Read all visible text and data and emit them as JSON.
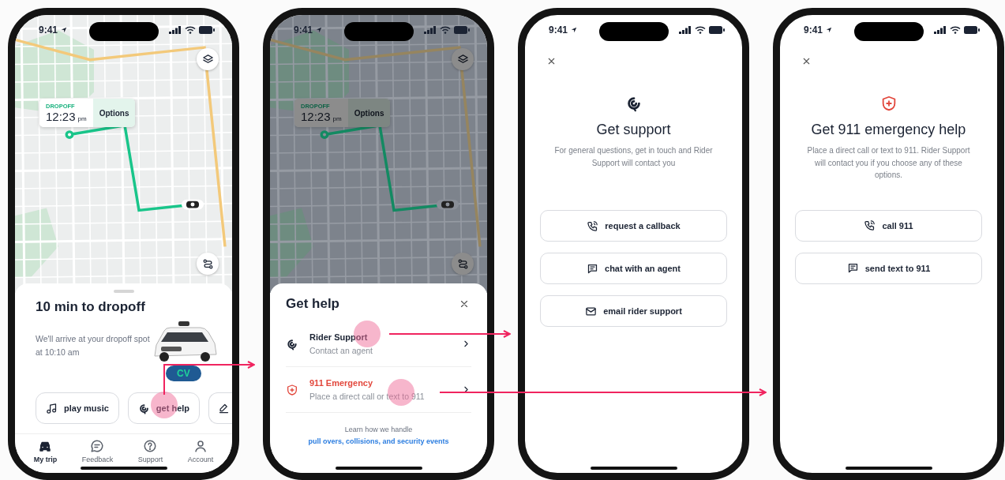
{
  "screens": [
    {
      "kind": "trip",
      "status_time": "9:41",
      "map": {
        "dropoff_label": "DROPOFF",
        "dropoff_time": "12:23",
        "time_suffix": "pm",
        "options_label": "Options"
      },
      "sheet": {
        "title": "10 min to dropoff",
        "message": "We'll arrive at your dropoff spot at 10:10 am",
        "vehicle_badge": "CV",
        "actions": [
          {
            "kind": "labeled",
            "label": "play music"
          },
          {
            "kind": "labeled",
            "label": "get help"
          },
          {
            "kind": "icon_only"
          }
        ]
      },
      "tabs": [
        {
          "label": "My trip",
          "selected": true
        },
        {
          "label": "Feedback",
          "selected": false
        },
        {
          "label": "Support",
          "selected": false
        },
        {
          "label": "Account",
          "selected": false
        }
      ]
    },
    {
      "kind": "help",
      "status_time": "9:41",
      "map": {
        "dropoff_label": "DROPOFF",
        "dropoff_time": "12:23",
        "time_suffix": "pm",
        "options_label": "Options"
      },
      "sheet": {
        "title": "Get help",
        "options": [
          {
            "kind": "support",
            "title": "Rider Support",
            "subtitle": "Contact an agent"
          },
          {
            "kind": "emergency",
            "title": "911 Emergency",
            "subtitle": "Place a direct call or text to 911"
          }
        ],
        "footer": {
          "text": "Learn how we handle",
          "link": "pull overs, collisions, and security events"
        }
      }
    },
    {
      "kind": "support",
      "status_time": "9:41",
      "title": "Get support",
      "description": "For general questions, get in touch and Rider Support will contact you",
      "buttons": [
        {
          "label": "request a callback"
        },
        {
          "label": "chat with an agent"
        },
        {
          "label": "email rider support"
        }
      ]
    },
    {
      "kind": "emergency",
      "status_time": "9:41",
      "title": "Get 911 emergency help",
      "description": "Place a direct call or text to 911. Rider Support will contact you if you choose any of these options.",
      "buttons": [
        {
          "label": "call 911"
        },
        {
          "label": "send text to 911"
        }
      ]
    }
  ]
}
